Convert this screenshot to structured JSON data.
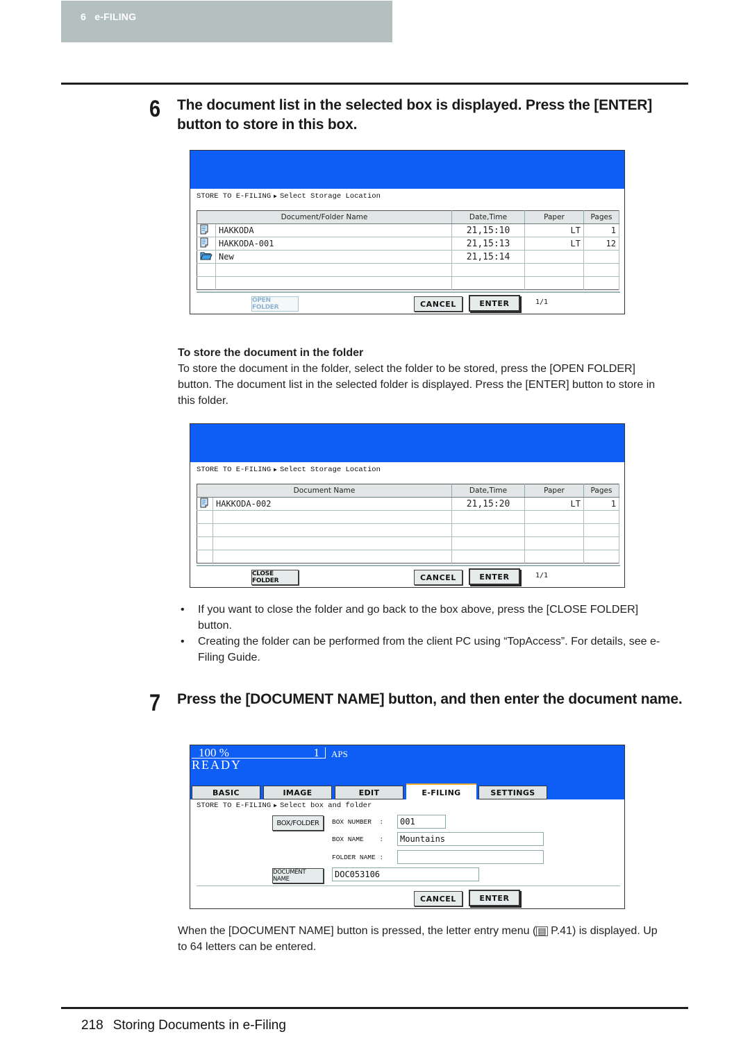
{
  "chapter": {
    "number": "6",
    "title": "e-FILING",
    "label": "6   e-FILING"
  },
  "step6": {
    "number": "6",
    "title": "The document list in the selected box is displayed. Press the [ENTER] button to store in this box."
  },
  "screen1": {
    "breadcrumb_root": "STORE TO E-FILING",
    "breadcrumb_page": "Select Storage Location",
    "columns": [
      "Document/Folder Name",
      "Date,Time",
      "Paper",
      "Pages"
    ],
    "rows": [
      {
        "icon": "document-icon",
        "name": "HAKKODA",
        "datetime": "21,15:10",
        "paper": "LT",
        "pages": "1"
      },
      {
        "icon": "document-icon",
        "name": "HAKKODA-001",
        "datetime": "21,15:13",
        "paper": "LT",
        "pages": "12"
      },
      {
        "icon": "folder-icon",
        "name": "New",
        "datetime": "21,15:14",
        "paper": "",
        "pages": ""
      },
      {
        "icon": "",
        "name": "",
        "datetime": "",
        "paper": "",
        "pages": ""
      },
      {
        "icon": "",
        "name": "",
        "datetime": "",
        "paper": "",
        "pages": ""
      }
    ],
    "folder_button": "OPEN FOLDER",
    "cancel": "CANCEL",
    "enter": "ENTER",
    "page_indicator": "1/1"
  },
  "folder_note": {
    "heading": "To store the document in the folder",
    "text": "To store the document in the folder, select the folder to be stored, press the [OPEN FOLDER] button. The document list in the selected folder is displayed. Press the [ENTER] button to store in this folder."
  },
  "screen2": {
    "breadcrumb_root": "STORE TO E-FILING",
    "breadcrumb_page": "Select Storage Location",
    "columns": [
      "Document Name",
      "Date,Time",
      "Paper",
      "Pages"
    ],
    "rows": [
      {
        "icon": "document-icon",
        "name": "HAKKODA-002",
        "datetime": "21,15:20",
        "paper": "LT",
        "pages": "1"
      },
      {
        "icon": "",
        "name": "",
        "datetime": "",
        "paper": "",
        "pages": ""
      },
      {
        "icon": "",
        "name": "",
        "datetime": "",
        "paper": "",
        "pages": ""
      },
      {
        "icon": "",
        "name": "",
        "datetime": "",
        "paper": "",
        "pages": ""
      },
      {
        "icon": "",
        "name": "",
        "datetime": "",
        "paper": "",
        "pages": ""
      }
    ],
    "folder_button": "CLOSE FOLDER",
    "cancel": "CANCEL",
    "enter": "ENTER",
    "page_indicator": "1/1"
  },
  "bullets": [
    "If you want to close the folder and go back to the box above, press the [CLOSE FOLDER] button.",
    "Creating the folder can be performed from the client PC using “TopAccess”. For details, see e-Filing Guide."
  ],
  "step7": {
    "number": "7",
    "title": "Press the [DOCUMENT NAME] button, and then enter the document name."
  },
  "screen3": {
    "zoom": "100 %",
    "copies": "1",
    "paper_mode": "APS",
    "status": "READY",
    "tabs": [
      {
        "label": "BASIC",
        "active": false
      },
      {
        "label": "IMAGE",
        "active": false
      },
      {
        "label": "EDIT",
        "active": false
      },
      {
        "label": "E-FILING",
        "active": true
      },
      {
        "label": "SETTINGS",
        "active": false
      }
    ],
    "breadcrumb_root": "STORE TO E-FILING",
    "breadcrumb_page": "Select box and folder",
    "box_folder_button": "BOX/FOLDER",
    "box_number_label": "BOX NUMBER  :",
    "box_number": "001",
    "box_name_label": "BOX NAME    :",
    "box_name": "Mountains",
    "folder_name_label": "FOLDER NAME :",
    "folder_name": "",
    "document_name_button": "DOCUMENT NAME",
    "document_name": "DOC053106",
    "cancel": "CANCEL",
    "enter": "ENTER"
  },
  "note7": {
    "text_before": "When the [DOCUMENT NAME] button is pressed, the letter entry menu (",
    "ref_icon": "book-icon",
    "ref": " P.41) is displayed. Up to 64 letters can be entered."
  },
  "footer": {
    "page": "218",
    "title": "Storing Documents in e-Filing"
  },
  "colors": {
    "screen_blue": "#0e5ef6",
    "chapter_tab": "#b4c0bf",
    "tab_active_accent": "#f0b030"
  }
}
